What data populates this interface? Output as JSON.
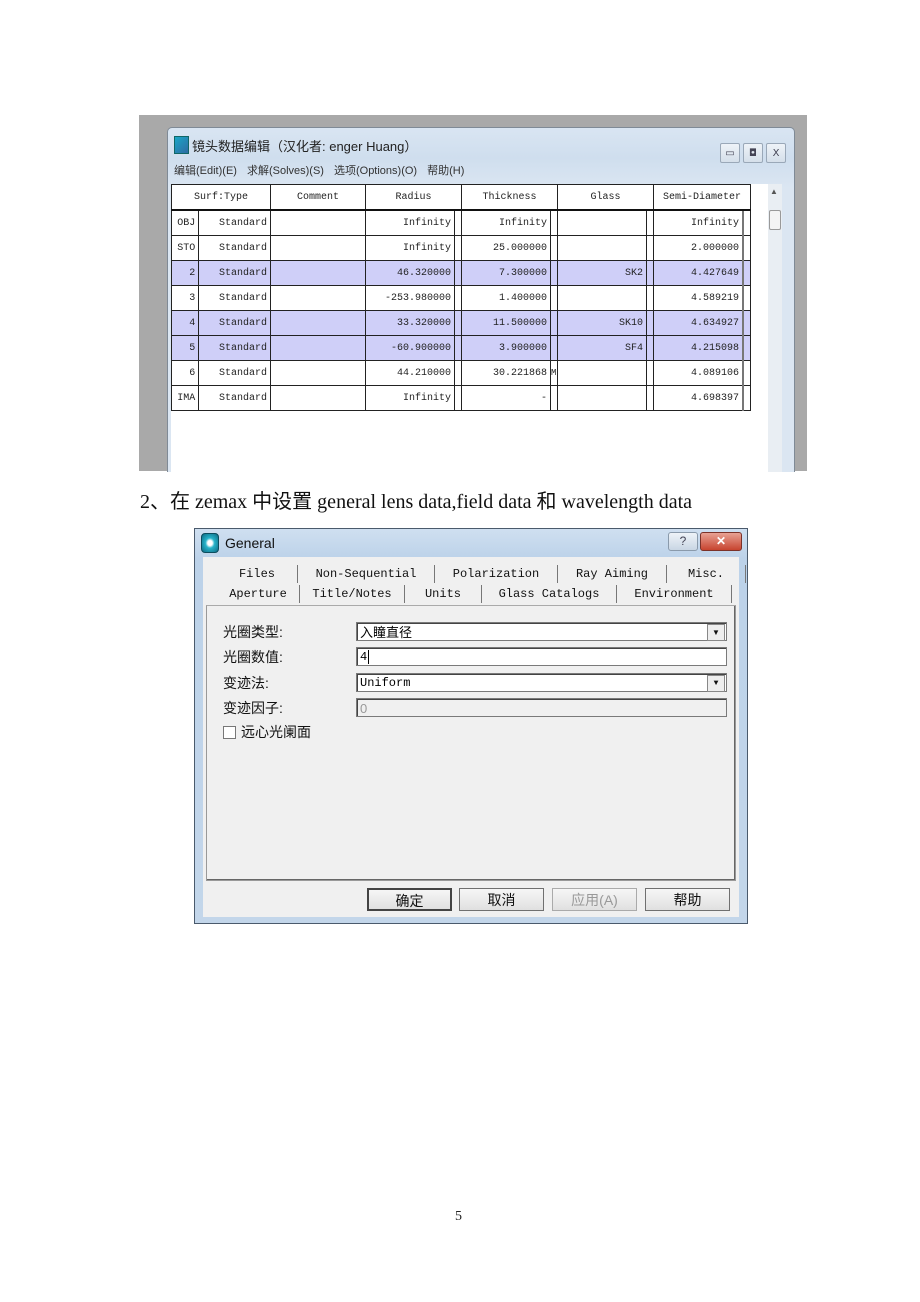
{
  "lens_editor": {
    "title": "镜头数据编辑（汉化者: enger Huang）",
    "window_buttons": {
      "minimize": "▭",
      "restore": "◘",
      "close": "X"
    },
    "menu": [
      "编辑(Edit)(E)",
      "求解(Solves)(S)",
      "选项(Options)(O)",
      "帮助(H)"
    ],
    "columns": [
      "Surf:Type",
      "Comment",
      "Radius",
      "Thickness",
      "Glass",
      "Semi-Diameter"
    ],
    "rows": [
      {
        "surf": "OBJ",
        "type": "Standard",
        "comment": "",
        "radius": "Infinity",
        "thickness": "Infinity",
        "thickness_solve": "",
        "glass": "",
        "semi_diameter": "Infinity",
        "selected": false
      },
      {
        "surf": "STO",
        "type": "Standard",
        "comment": "",
        "radius": "Infinity",
        "thickness": "25.000000",
        "thickness_solve": "",
        "glass": "",
        "semi_diameter": "2.000000",
        "selected": false
      },
      {
        "surf": "2",
        "type": "Standard",
        "comment": "",
        "radius": "46.320000",
        "thickness": "7.300000",
        "thickness_solve": "",
        "glass": "SK2",
        "semi_diameter": "4.427649",
        "selected": true
      },
      {
        "surf": "3",
        "type": "Standard",
        "comment": "",
        "radius": "-253.980000",
        "thickness": "1.400000",
        "thickness_solve": "",
        "glass": "",
        "semi_diameter": "4.589219",
        "selected": false
      },
      {
        "surf": "4",
        "type": "Standard",
        "comment": "",
        "radius": "33.320000",
        "thickness": "11.500000",
        "thickness_solve": "",
        "glass": "SK10",
        "semi_diameter": "4.634927",
        "selected": true
      },
      {
        "surf": "5",
        "type": "Standard",
        "comment": "",
        "radius": "-60.900000",
        "thickness": "3.900000",
        "thickness_solve": "",
        "glass": "SF4",
        "semi_diameter": "4.215098",
        "selected": true
      },
      {
        "surf": "6",
        "type": "Standard",
        "comment": "",
        "radius": "44.210000",
        "thickness": "30.221868",
        "thickness_solve": "M",
        "glass": "",
        "semi_diameter": "4.089106",
        "selected": false
      },
      {
        "surf": "IMA",
        "type": "Standard",
        "comment": "",
        "radius": "Infinity",
        "thickness": "-",
        "thickness_solve": "",
        "glass": "",
        "semi_diameter": "4.698397",
        "selected": false
      }
    ]
  },
  "paragraph": "2、在 zemax 中设置 general lens data,field data 和 wavelength data",
  "general_dialog": {
    "title": "General",
    "help_button": "?",
    "close_button": "✕",
    "tabs_row1": [
      "Files",
      "Non-Sequential",
      "Polarization",
      "Ray Aiming",
      "Misc."
    ],
    "tabs_row2": [
      "Aperture",
      "Title/Notes",
      "Units",
      "Glass Catalogs",
      "Environment"
    ],
    "active_tab": "Aperture",
    "fields": {
      "aperture_type_label": "光圈类型:",
      "aperture_type_value": "入瞳直径",
      "aperture_value_label": "光圈数值:",
      "aperture_value": "4",
      "apodization_label": "变迹法:",
      "apodization_value": "Uniform",
      "apodization_factor_label": "变迹因子:",
      "apodization_factor_value": "0",
      "telecentric_label": "远心光阑面",
      "telecentric_checked": false
    },
    "buttons": {
      "ok": "确定",
      "cancel": "取消",
      "apply": "应用(A)",
      "help": "帮助"
    }
  },
  "page_number": "5"
}
